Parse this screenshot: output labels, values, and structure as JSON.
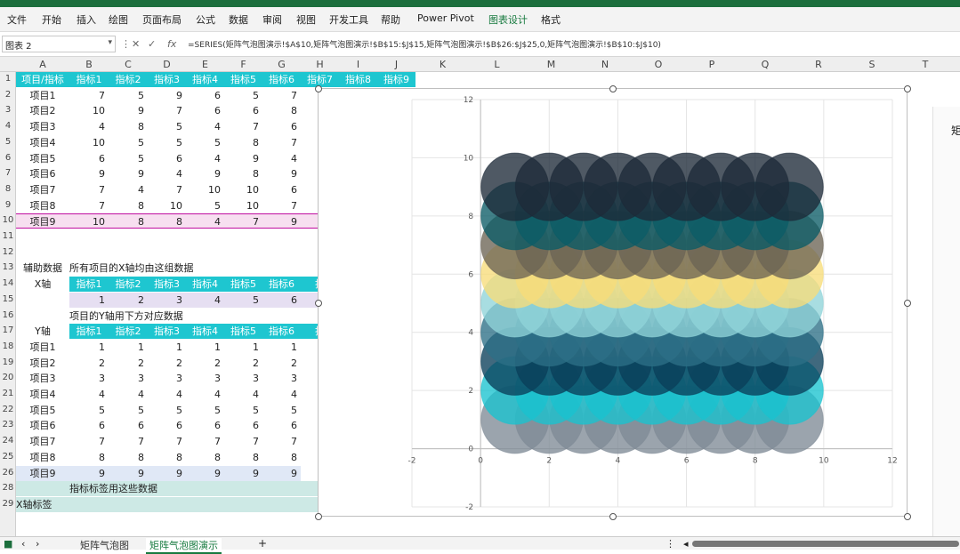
{
  "ribbon": {
    "tabs": [
      "文件",
      "开始",
      "插入",
      "绘图",
      "页面布局",
      "公式",
      "数据",
      "审阅",
      "视图",
      "开发工具",
      "帮助",
      "Power Pivot",
      "图表设计",
      "格式"
    ],
    "active_tab": "图表设计"
  },
  "formula_bar": {
    "name_box": "图表 2",
    "fx": "fx",
    "formula": "=SERIES(矩阵气泡图演示!$A$10,矩阵气泡图演示!$B$15:$J$15,矩阵气泡图演示!$B$26:$J$25,0,矩阵气泡图演示!$B$10:$J$10)"
  },
  "columns": [
    "A",
    "B",
    "C",
    "D",
    "E",
    "F",
    "G",
    "H",
    "I",
    "J",
    "K",
    "L",
    "M",
    "N",
    "O",
    "P",
    "Q",
    "R",
    "S",
    "T"
  ],
  "rows": [
    "1",
    "2",
    "3",
    "4",
    "5",
    "6",
    "7",
    "8",
    "9",
    "10",
    "11",
    "12",
    "13",
    "14",
    "15",
    "16",
    "17",
    "18",
    "19",
    "20",
    "21",
    "22",
    "23",
    "24",
    "25",
    "26",
    "28",
    "29"
  ],
  "table1": {
    "headers": [
      "项目/指标",
      "指标1",
      "指标2",
      "指标3",
      "指标4",
      "指标5",
      "指标6",
      "指标7",
      "指标8",
      "指标9"
    ],
    "rows": [
      {
        "label": "项目1",
        "vals": [
          "7",
          "5",
          "9",
          "6",
          "5",
          "7"
        ]
      },
      {
        "label": "项目2",
        "vals": [
          "10",
          "9",
          "7",
          "6",
          "6",
          "8"
        ]
      },
      {
        "label": "项目3",
        "vals": [
          "4",
          "8",
          "5",
          "4",
          "7",
          "6"
        ]
      },
      {
        "label": "项目4",
        "vals": [
          "10",
          "5",
          "5",
          "5",
          "8",
          "7"
        ]
      },
      {
        "label": "项目5",
        "vals": [
          "6",
          "5",
          "6",
          "4",
          "9",
          "4"
        ]
      },
      {
        "label": "项目6",
        "vals": [
          "9",
          "9",
          "4",
          "9",
          "8",
          "9"
        ]
      },
      {
        "label": "项目7",
        "vals": [
          "7",
          "4",
          "7",
          "10",
          "10",
          "6"
        ]
      },
      {
        "label": "项目8",
        "vals": [
          "7",
          "8",
          "10",
          "5",
          "10",
          "7"
        ]
      },
      {
        "label": "项目9",
        "vals": [
          "10",
          "8",
          "8",
          "4",
          "7",
          "9"
        ]
      }
    ]
  },
  "helper": {
    "a13": "辅助数据",
    "b13": "所有项目的X轴均由这组数据",
    "a14": "X轴",
    "x_headers": [
      "指标1",
      "指标2",
      "指标3",
      "指标4",
      "指标5",
      "指标6",
      "指"
    ],
    "x_vals": [
      "1",
      "2",
      "3",
      "4",
      "5",
      "6"
    ],
    "b16": "项目的Y轴用下方对应数据",
    "a17": "Y轴",
    "y_headers": [
      "指标1",
      "指标2",
      "指标3",
      "指标4",
      "指标5",
      "指标6",
      "指"
    ],
    "y_rows": [
      {
        "label": "项目1",
        "vals": [
          "1",
          "1",
          "1",
          "1",
          "1",
          "1"
        ]
      },
      {
        "label": "项目2",
        "vals": [
          "2",
          "2",
          "2",
          "2",
          "2",
          "2"
        ]
      },
      {
        "label": "项目3",
        "vals": [
          "3",
          "3",
          "3",
          "3",
          "3",
          "3"
        ]
      },
      {
        "label": "项目4",
        "vals": [
          "4",
          "4",
          "4",
          "4",
          "4",
          "4"
        ]
      },
      {
        "label": "项目5",
        "vals": [
          "5",
          "5",
          "5",
          "5",
          "5",
          "5"
        ]
      },
      {
        "label": "项目6",
        "vals": [
          "6",
          "6",
          "6",
          "6",
          "6",
          "6"
        ]
      },
      {
        "label": "项目7",
        "vals": [
          "7",
          "7",
          "7",
          "7",
          "7",
          "7"
        ]
      },
      {
        "label": "项目8",
        "vals": [
          "8",
          "8",
          "8",
          "8",
          "8",
          "8"
        ]
      },
      {
        "label": "项目9",
        "vals": [
          "9",
          "9",
          "9",
          "9",
          "9",
          "9"
        ]
      }
    ],
    "b28": "指标标签用这些数据",
    "a29": "X轴标签"
  },
  "chart_data": {
    "type": "scatter",
    "subtype": "bubble",
    "xlim": [
      -2,
      12
    ],
    "ylim": [
      -2,
      12
    ],
    "x_ticks": [
      "-2",
      "0",
      "2",
      "4",
      "6",
      "8",
      "10",
      "12"
    ],
    "y_ticks": [
      "-2",
      "0",
      "2",
      "4",
      "6",
      "8",
      "10",
      "12"
    ],
    "series": [
      {
        "color": "#7f8b96",
        "x": [
          1,
          2,
          3,
          4,
          5,
          6,
          7,
          8,
          9
        ],
        "y": [
          1,
          1,
          1,
          1,
          1,
          1,
          1,
          1,
          1
        ]
      },
      {
        "color": "#19c3cf",
        "x": [
          1,
          2,
          3,
          4,
          5,
          6,
          7,
          8,
          9
        ],
        "y": [
          2,
          2,
          2,
          2,
          2,
          2,
          2,
          2,
          2
        ]
      },
      {
        "color": "#0a3f5a",
        "x": [
          1,
          2,
          3,
          4,
          5,
          6,
          7,
          8,
          9
        ],
        "y": [
          3,
          3,
          3,
          3,
          3,
          3,
          3,
          3,
          3
        ]
      },
      {
        "color": "#2d6f86",
        "x": [
          1,
          2,
          3,
          4,
          5,
          6,
          7,
          8,
          9
        ],
        "y": [
          4,
          4,
          4,
          4,
          4,
          4,
          4,
          4,
          4
        ]
      },
      {
        "color": "#8fd3d9",
        "x": [
          1,
          2,
          3,
          4,
          5,
          6,
          7,
          8,
          9
        ],
        "y": [
          5,
          5,
          5,
          5,
          5,
          5,
          5,
          5,
          5
        ]
      },
      {
        "color": "#f7dd7a",
        "x": [
          1,
          2,
          3,
          4,
          5,
          6,
          7,
          8,
          9
        ],
        "y": [
          6,
          6,
          6,
          6,
          6,
          6,
          6,
          6,
          6
        ]
      },
      {
        "color": "#6c6455",
        "x": [
          1,
          2,
          3,
          4,
          5,
          6,
          7,
          8,
          9
        ],
        "y": [
          7,
          7,
          7,
          7,
          7,
          7,
          7,
          7,
          7
        ]
      },
      {
        "color": "#0b5c66",
        "x": [
          1,
          2,
          3,
          4,
          5,
          6,
          7,
          8,
          9
        ],
        "y": [
          8,
          8,
          8,
          8,
          8,
          8,
          8,
          8,
          8
        ]
      },
      {
        "color": "#1d2a38",
        "x": [
          1,
          2,
          3,
          4,
          5,
          6,
          7,
          8,
          9
        ],
        "y": [
          9,
          9,
          9,
          9,
          9,
          9,
          9,
          9,
          9
        ]
      }
    ]
  },
  "side_pane": {
    "label": "矩"
  },
  "sheet_tabs": [
    "矩阵气泡图",
    "矩阵气泡图演示"
  ],
  "active_sheet": "矩阵气泡图演示",
  "add_sheet": "+",
  "colors": {
    "header_teal": "#1ec6d0",
    "ribbon_green": "#1b6e3c",
    "highlight": "#c00ea0"
  }
}
